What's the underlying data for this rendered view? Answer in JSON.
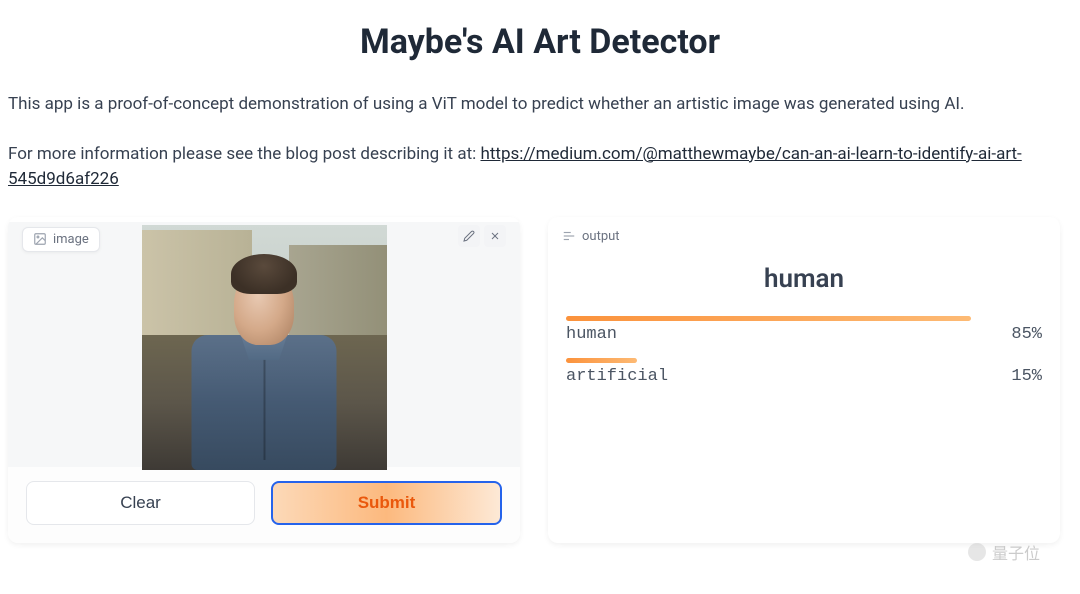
{
  "header": {
    "title": "Maybe's AI Art Detector"
  },
  "description": {
    "intro": "This app is a proof-of-concept demonstration of using a ViT model to predict whether an artistic image was generated using AI.",
    "more_info_prefix": "For more information please see the blog post describing it at: ",
    "link_text": "https://medium.com/@matthewmaybe/can-an-ai-learn-to-identify-ai-art-545d9d6af226"
  },
  "input_panel": {
    "label": "image",
    "buttons": {
      "clear": "Clear",
      "submit": "Submit"
    }
  },
  "output_panel": {
    "label": "output",
    "prediction": "human",
    "results": [
      {
        "label": "human",
        "value": 85,
        "display": "85%"
      },
      {
        "label": "artificial",
        "value": 15,
        "display": "15%"
      }
    ]
  },
  "chart_data": {
    "type": "bar",
    "categories": [
      "human",
      "artificial"
    ],
    "values": [
      85,
      15
    ],
    "title": "human",
    "xlabel": "",
    "ylabel": "",
    "ylim": [
      0,
      100
    ]
  },
  "watermark": {
    "text": "量子位"
  }
}
